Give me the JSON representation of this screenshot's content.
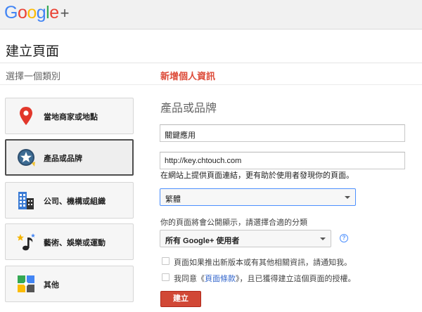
{
  "header": {
    "logo_text": "Google",
    "logo_plus": "+"
  },
  "page_title": "建立頁面",
  "steps": {
    "step1": "選擇一個類別",
    "step2": "新增個人資訊"
  },
  "categories": [
    {
      "label": "當地商家或地點",
      "icon": "map-pin-icon",
      "selected": false
    },
    {
      "label": "產品或品牌",
      "icon": "star-badge-icon",
      "selected": true
    },
    {
      "label": "公司、機構或組織",
      "icon": "building-icon",
      "selected": false
    },
    {
      "label": "藝術、娛樂或運動",
      "icon": "music-note-icon",
      "selected": false
    },
    {
      "label": "其他",
      "icon": "tiles-icon",
      "selected": false
    }
  ],
  "form": {
    "heading": "產品或品牌",
    "name_value": "關鍵應用",
    "url_value": "http://key.chtouch.com",
    "url_help": "在網站上提供頁面連結，更有助於使用者發現你的頁面。",
    "category_value": "繁體",
    "visibility_help": "你的頁面將會公開顯示，請選擇合適的分類",
    "audience_value": "所有 Google+ 使用者",
    "help_mark": "?",
    "checkbox1_label": "頁面如果推出新版本或有其他相關資訊，請通知我。",
    "checkbox2_prefix": "我同意《",
    "checkbox2_link": "頁面條款",
    "checkbox2_suffix": "》，且已獲得建立這個頁面的授權。",
    "create_button": "建立"
  },
  "colors": {
    "accent_red": "#dd4b39",
    "button_red": "#d14836",
    "link_blue": "#3366cc",
    "focus_blue": "#4d90fe"
  }
}
